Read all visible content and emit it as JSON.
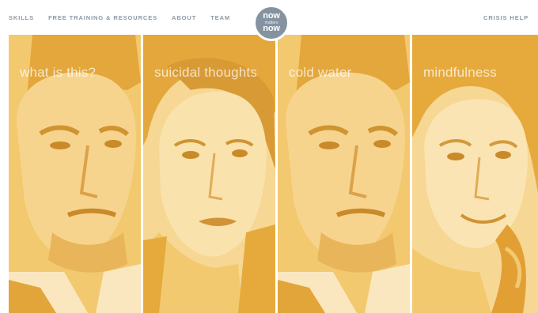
{
  "nav": {
    "left": [
      "SKILLS",
      "FREE TRAINING & RESOURCES",
      "ABOUT",
      "TEAM"
    ],
    "right": "CRISIS HELP"
  },
  "logo": {
    "top": "now",
    "middle": "matters",
    "bottom": "now"
  },
  "tiles": [
    {
      "label": "what is this?"
    },
    {
      "label": "suicidal thoughts"
    },
    {
      "label": "cold water"
    },
    {
      "label": "mindfulness"
    }
  ],
  "colors": {
    "tile_base": "#f3c96f",
    "tile_dark": "#e6aa3c",
    "tile_light": "#fbe7bf",
    "nav_text": "#8d99a6",
    "logo_bg": "#8593a1"
  }
}
